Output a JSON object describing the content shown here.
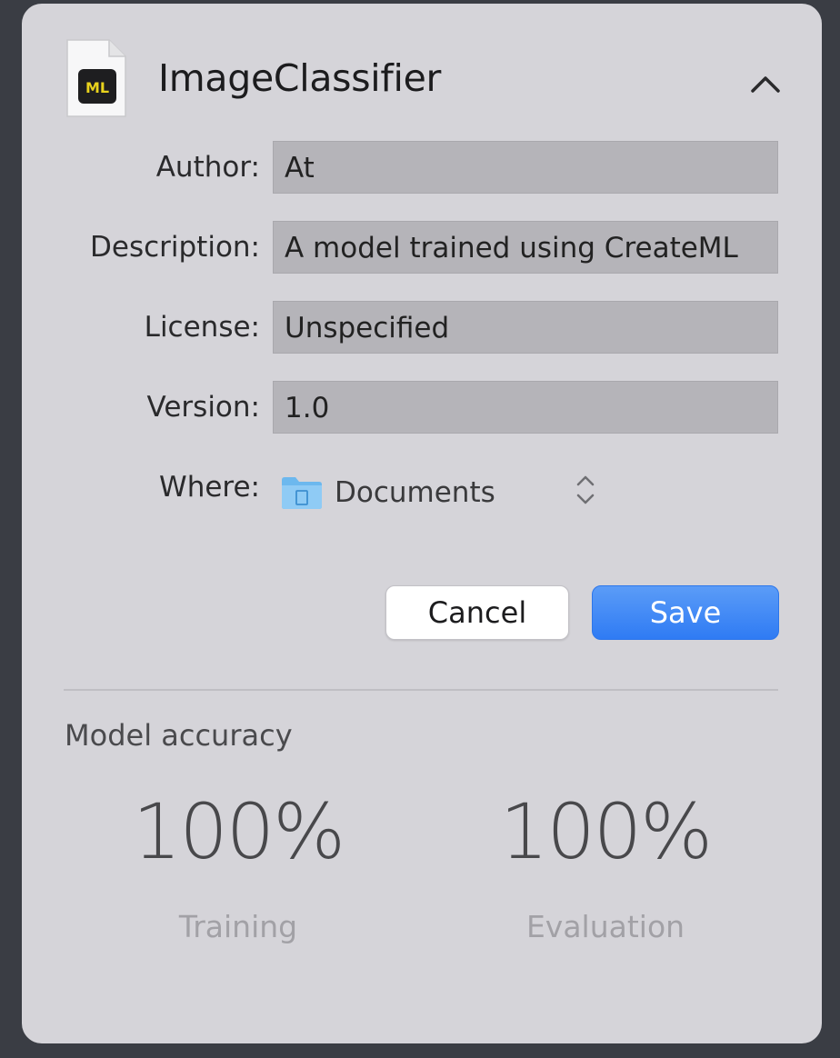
{
  "header": {
    "title": "ImageClassifier",
    "file_icon_text": "ML"
  },
  "form": {
    "author_label": "Author:",
    "author_value": "At",
    "description_label": "Description:",
    "description_value": "A model trained using CreateML",
    "license_label": "License:",
    "license_value": "Unspecified",
    "version_label": "Version:",
    "version_value": "1.0",
    "where_label": "Where:",
    "where_value": "Documents"
  },
  "buttons": {
    "cancel_label": "Cancel",
    "save_label": "Save"
  },
  "accuracy": {
    "title": "Model accuracy",
    "training_value": "100%",
    "training_label": "Training",
    "evaluation_value": "100%",
    "evaluation_label": "Evaluation"
  },
  "colors": {
    "accent": "#2f7bf4",
    "panel_bg": "#d5d4d9",
    "window_bg": "#3a3d44",
    "ml_badge": "#e8d21d"
  },
  "icons": {
    "file": "mlmodel-file-icon",
    "collapse": "chevron-up-icon",
    "folder": "folder-icon",
    "stepper": "up-down-chevron-icon"
  }
}
